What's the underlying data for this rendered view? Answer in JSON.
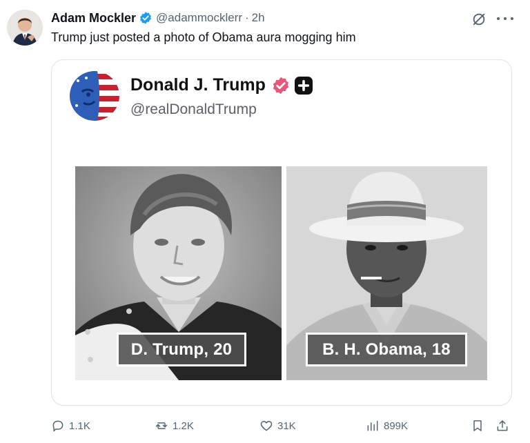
{
  "tweet": {
    "author_name": "Adam Mockler",
    "handle": "@adammocklerr",
    "separator": "·",
    "time": "2h",
    "text": "Trump just posted a photo of Obama aura mogging him",
    "verified_color": "#1d9bf0"
  },
  "embedded_post": {
    "author_name": "Donald J. Trump",
    "handle": "@realDonaldTrump",
    "badge_color": "#e8577a",
    "photos": [
      {
        "caption": "D. Trump, 20"
      },
      {
        "caption": "B. H. Obama, 18"
      }
    ]
  },
  "actions": {
    "replies": "1.1K",
    "reposts": "1.2K",
    "likes": "31K",
    "views": "899K"
  }
}
